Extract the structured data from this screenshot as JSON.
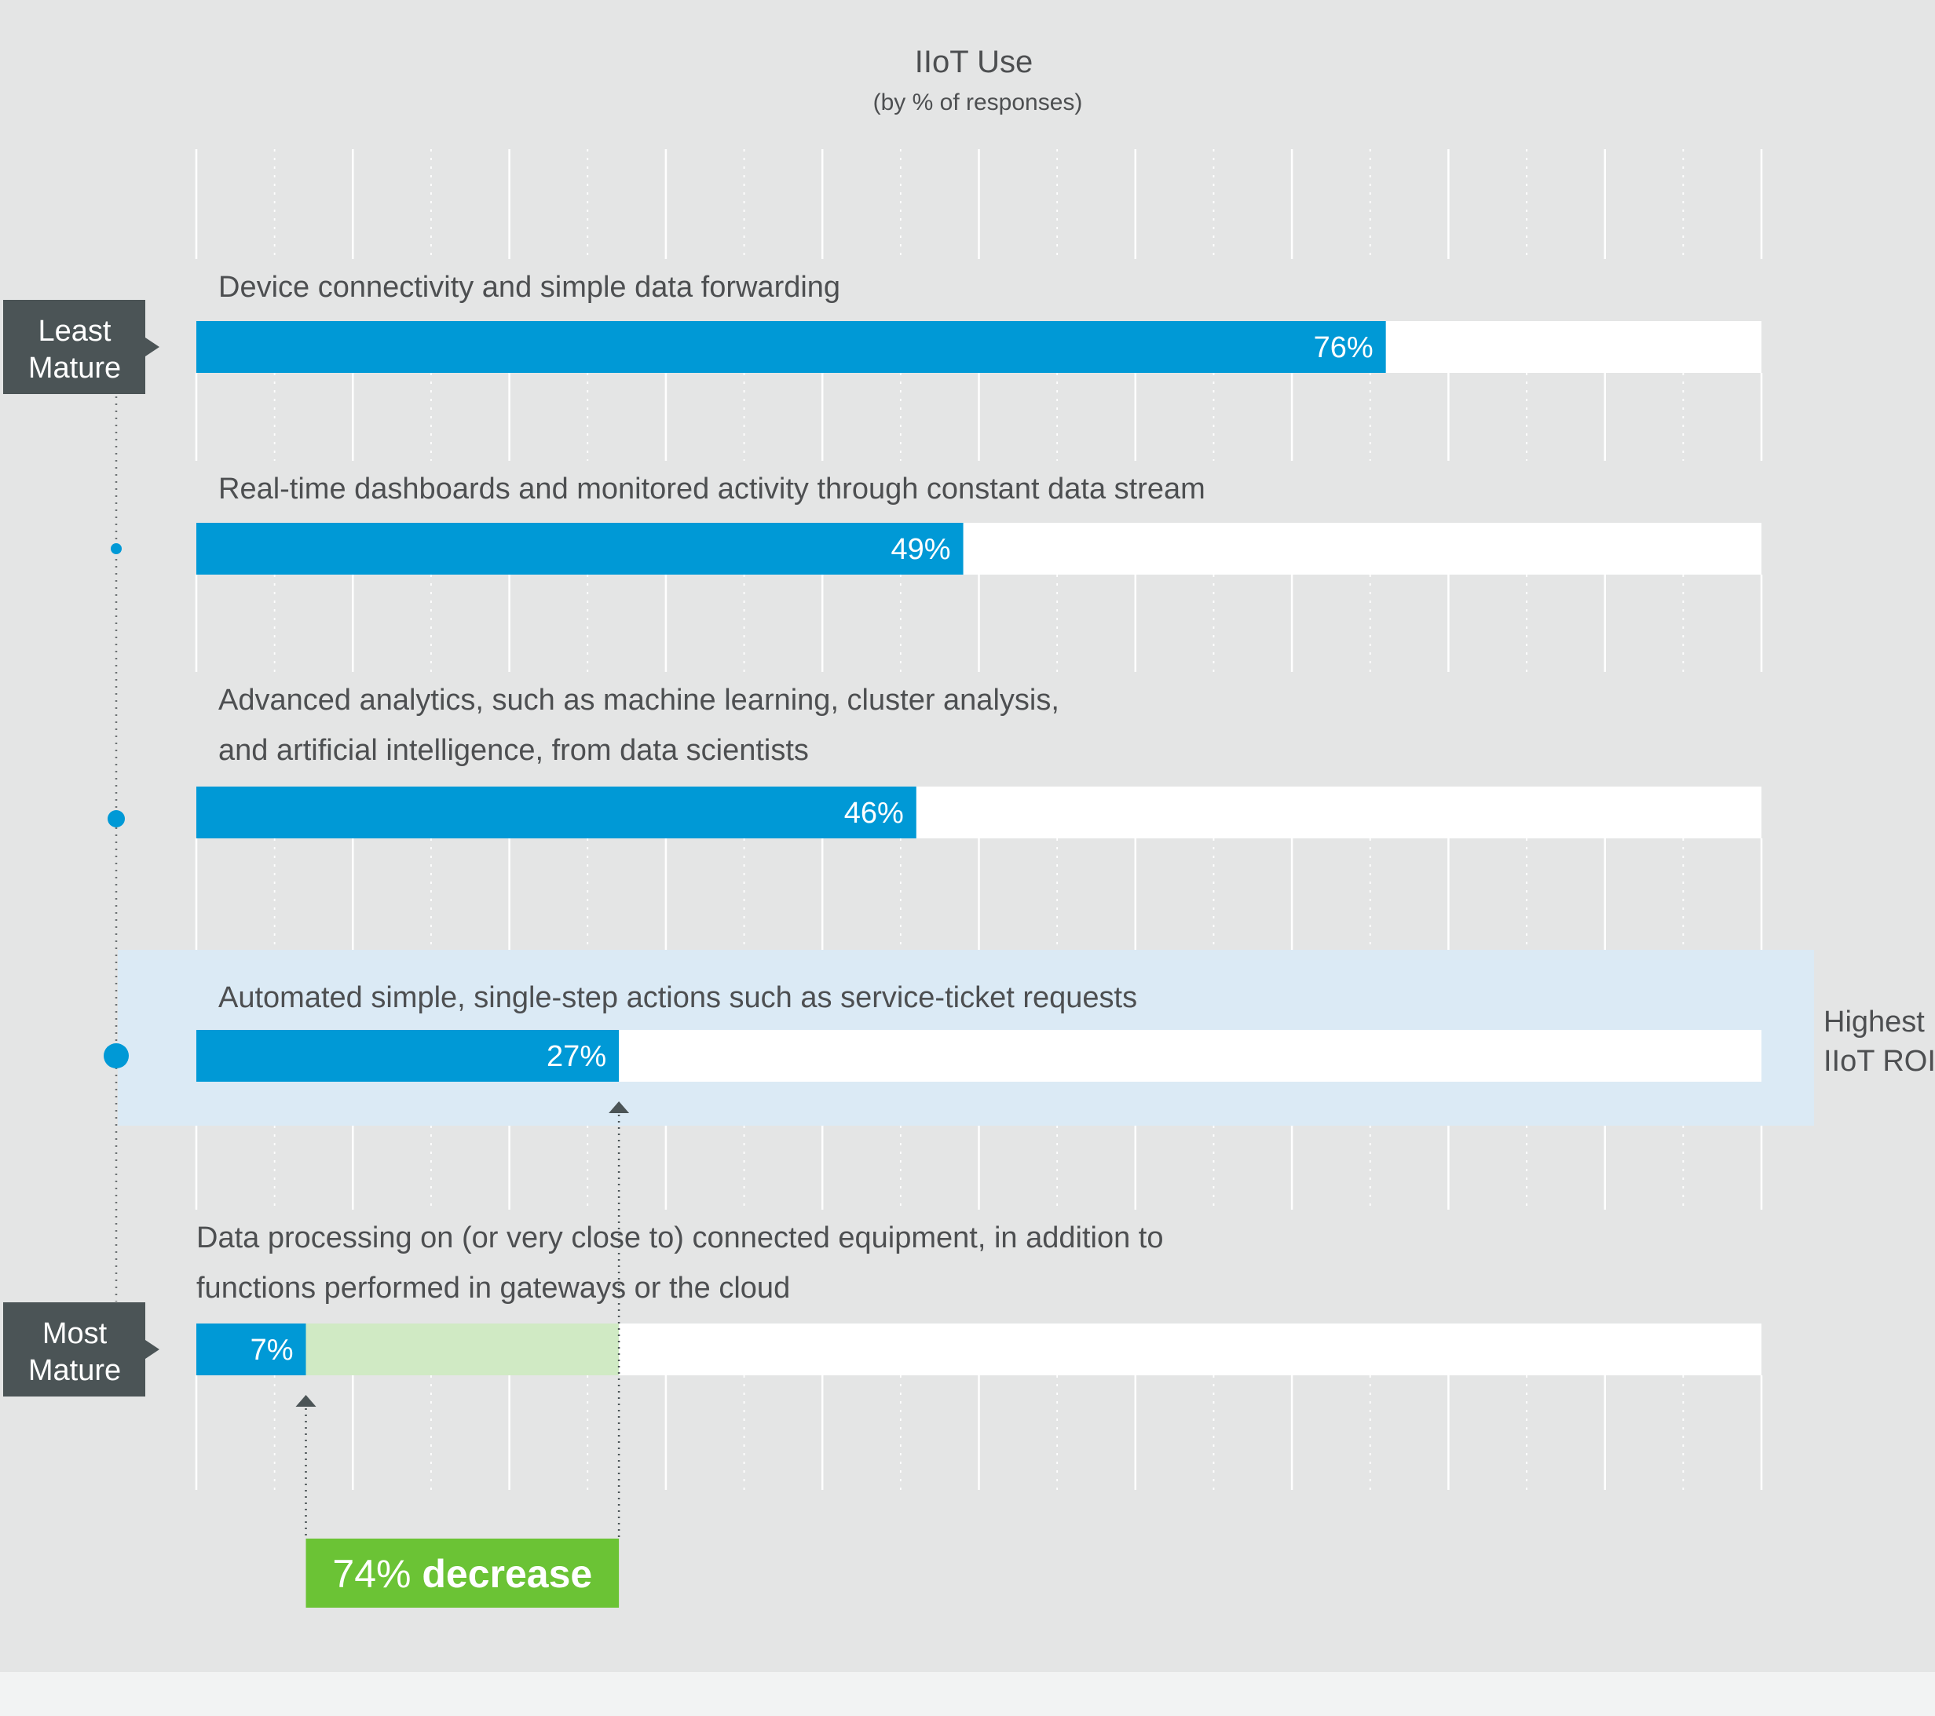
{
  "chart_data": {
    "type": "bar",
    "orientation": "horizontal",
    "title": "IIoT Use",
    "subtitle": "(by % of responses)",
    "xlim": [
      0,
      100
    ],
    "grid": true,
    "categories": [
      "Device connectivity and simple data forwarding",
      "Real-time dashboards and monitored activity through constant data stream",
      "Advanced analytics, such as machine learning, cluster analysis, and artificial intelligence, from data scientists",
      "Automated simple, single-step actions such as service-ticket requests",
      "Data processing on (or very close to) connected equipment, in addition to functions performed in gateways or the cloud"
    ],
    "category_lines": [
      [
        "Device connectivity and simple data forwarding"
      ],
      [
        "Real-time dashboards and monitored activity through constant data stream"
      ],
      [
        "Advanced analytics, such as machine learning, cluster analysis,",
        "and artificial intelligence, from data scientists"
      ],
      [
        "Automated simple, single-step actions such as service-ticket requests"
      ],
      [
        "Data processing on (or very close to) connected equipment, in addition to",
        "functions performed in gateways or the cloud"
      ]
    ],
    "values": [
      76,
      49,
      46,
      27,
      7
    ],
    "value_labels": [
      "76%",
      "49%",
      "46%",
      "27%",
      "7%"
    ],
    "maturity_labels": {
      "least": [
        "Least",
        "Mature"
      ],
      "most": [
        "Most",
        "Mature"
      ]
    },
    "highlight": {
      "category_index": 3,
      "label_lines": [
        "Highest",
        "IIoT ROI"
      ]
    },
    "decrease": {
      "from": 27,
      "to": 7,
      "label_number": "74%",
      "label_word": "decrease"
    },
    "colors": {
      "bar": "#0099d6",
      "track": "#ffffff",
      "background": "#e4e5e5",
      "highlight_band": "#dbeaf5",
      "decrease_gap": "#d0eac4",
      "decrease_badge": "#6bc335",
      "maturity_tag": "#4b5456",
      "text": "#4d4f51",
      "gridline": "#ffffff"
    }
  }
}
